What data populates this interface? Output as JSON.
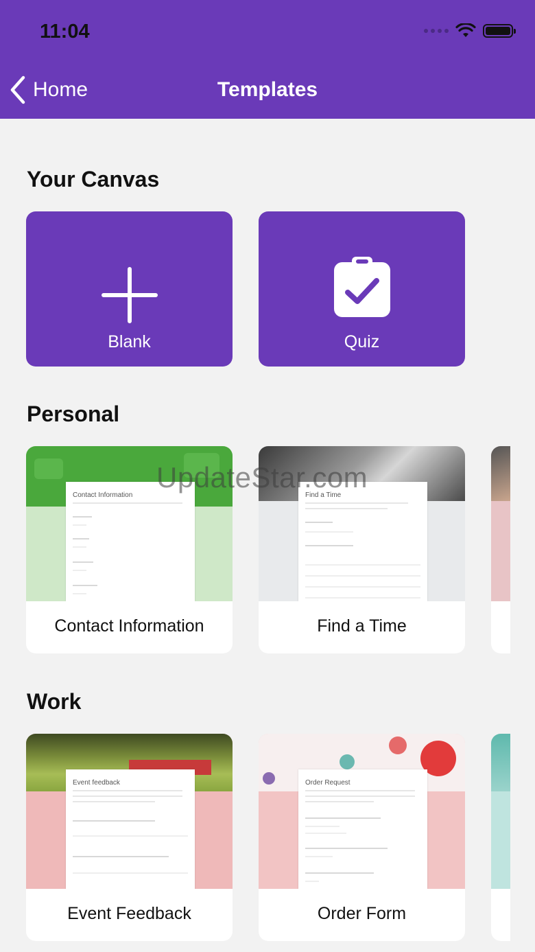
{
  "status": {
    "time": "11:04"
  },
  "nav": {
    "back_label": "Home",
    "title": "Templates"
  },
  "sections": {
    "canvas": {
      "title": "Your Canvas",
      "tiles": [
        {
          "label": "Blank",
          "icon": "plus-icon"
        },
        {
          "label": "Quiz",
          "icon": "clipboard-check-icon"
        }
      ]
    },
    "personal": {
      "title": "Personal",
      "cards": [
        {
          "label": "Contact Information",
          "preview_title": "Contact Information"
        },
        {
          "label": "Find a Time",
          "preview_title": "Find a Time"
        }
      ]
    },
    "work": {
      "title": "Work",
      "cards": [
        {
          "label": "Event Feedback",
          "preview_title": "Event feedback"
        },
        {
          "label": "Order Form",
          "preview_title": "Order Request"
        }
      ]
    }
  },
  "watermark": "UpdateStar.com",
  "colors": {
    "accent": "#6a3ab8",
    "background": "#f2f2f2"
  }
}
